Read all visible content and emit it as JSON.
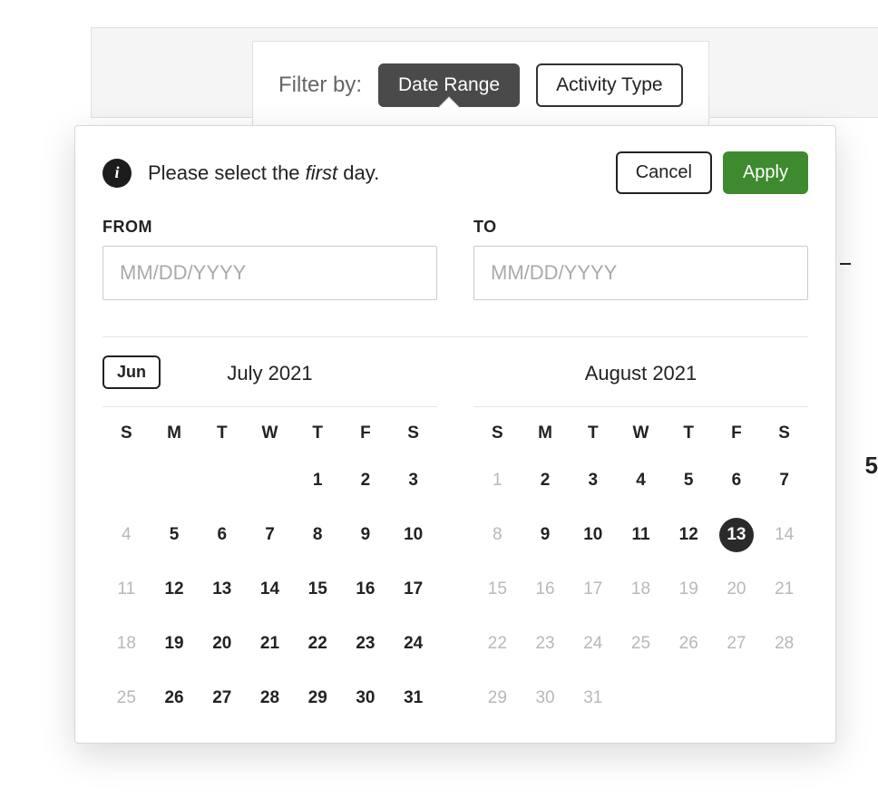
{
  "filter": {
    "label": "Filter by:",
    "date_range_label": "Date Range",
    "activity_type_label": "Activity Type"
  },
  "popover": {
    "info_glyph": "i",
    "message_prefix": "Please select the ",
    "message_emphasis": "first",
    "message_suffix": " day.",
    "cancel_label": "Cancel",
    "apply_label": "Apply"
  },
  "inputs": {
    "from_label": "FROM",
    "to_label": "TO",
    "from_value": "",
    "to_value": "",
    "placeholder": "MM/DD/YYYY"
  },
  "calendar_left": {
    "prev_button_label": "Jun",
    "title": "July 2021",
    "dow": [
      "S",
      "M",
      "T",
      "W",
      "T",
      "F",
      "S"
    ],
    "days": [
      {
        "n": "",
        "disabled": false,
        "empty": true
      },
      {
        "n": "",
        "disabled": false,
        "empty": true
      },
      {
        "n": "",
        "disabled": false,
        "empty": true
      },
      {
        "n": "",
        "disabled": false,
        "empty": true
      },
      {
        "n": "1",
        "disabled": false
      },
      {
        "n": "2",
        "disabled": false
      },
      {
        "n": "3",
        "disabled": false
      },
      {
        "n": "4",
        "disabled": true
      },
      {
        "n": "5",
        "disabled": false
      },
      {
        "n": "6",
        "disabled": false
      },
      {
        "n": "7",
        "disabled": false
      },
      {
        "n": "8",
        "disabled": false
      },
      {
        "n": "9",
        "disabled": false
      },
      {
        "n": "10",
        "disabled": false
      },
      {
        "n": "11",
        "disabled": true
      },
      {
        "n": "12",
        "disabled": false
      },
      {
        "n": "13",
        "disabled": false
      },
      {
        "n": "14",
        "disabled": false
      },
      {
        "n": "15",
        "disabled": false
      },
      {
        "n": "16",
        "disabled": false
      },
      {
        "n": "17",
        "disabled": false
      },
      {
        "n": "18",
        "disabled": true
      },
      {
        "n": "19",
        "disabled": false
      },
      {
        "n": "20",
        "disabled": false
      },
      {
        "n": "21",
        "disabled": false
      },
      {
        "n": "22",
        "disabled": false
      },
      {
        "n": "23",
        "disabled": false
      },
      {
        "n": "24",
        "disabled": false
      },
      {
        "n": "25",
        "disabled": true
      },
      {
        "n": "26",
        "disabled": false
      },
      {
        "n": "27",
        "disabled": false
      },
      {
        "n": "28",
        "disabled": false
      },
      {
        "n": "29",
        "disabled": false
      },
      {
        "n": "30",
        "disabled": false
      },
      {
        "n": "31",
        "disabled": false
      }
    ]
  },
  "calendar_right": {
    "title": "August 2021",
    "dow": [
      "S",
      "M",
      "T",
      "W",
      "T",
      "F",
      "S"
    ],
    "days": [
      {
        "n": "1",
        "disabled": true
      },
      {
        "n": "2",
        "disabled": false
      },
      {
        "n": "3",
        "disabled": false
      },
      {
        "n": "4",
        "disabled": false
      },
      {
        "n": "5",
        "disabled": false
      },
      {
        "n": "6",
        "disabled": false
      },
      {
        "n": "7",
        "disabled": false
      },
      {
        "n": "8",
        "disabled": true
      },
      {
        "n": "9",
        "disabled": false
      },
      {
        "n": "10",
        "disabled": false
      },
      {
        "n": "11",
        "disabled": false
      },
      {
        "n": "12",
        "disabled": false
      },
      {
        "n": "13",
        "disabled": false,
        "selected": true
      },
      {
        "n": "14",
        "disabled": true
      },
      {
        "n": "15",
        "disabled": true
      },
      {
        "n": "16",
        "disabled": true
      },
      {
        "n": "17",
        "disabled": true
      },
      {
        "n": "18",
        "disabled": true
      },
      {
        "n": "19",
        "disabled": true
      },
      {
        "n": "20",
        "disabled": true
      },
      {
        "n": "21",
        "disabled": true
      },
      {
        "n": "22",
        "disabled": true
      },
      {
        "n": "23",
        "disabled": true
      },
      {
        "n": "24",
        "disabled": true
      },
      {
        "n": "25",
        "disabled": true
      },
      {
        "n": "26",
        "disabled": true
      },
      {
        "n": "27",
        "disabled": true
      },
      {
        "n": "28",
        "disabled": true
      },
      {
        "n": "29",
        "disabled": true
      },
      {
        "n": "30",
        "disabled": true
      },
      {
        "n": "31",
        "disabled": true
      }
    ]
  },
  "side": {
    "partial_text": "5"
  }
}
